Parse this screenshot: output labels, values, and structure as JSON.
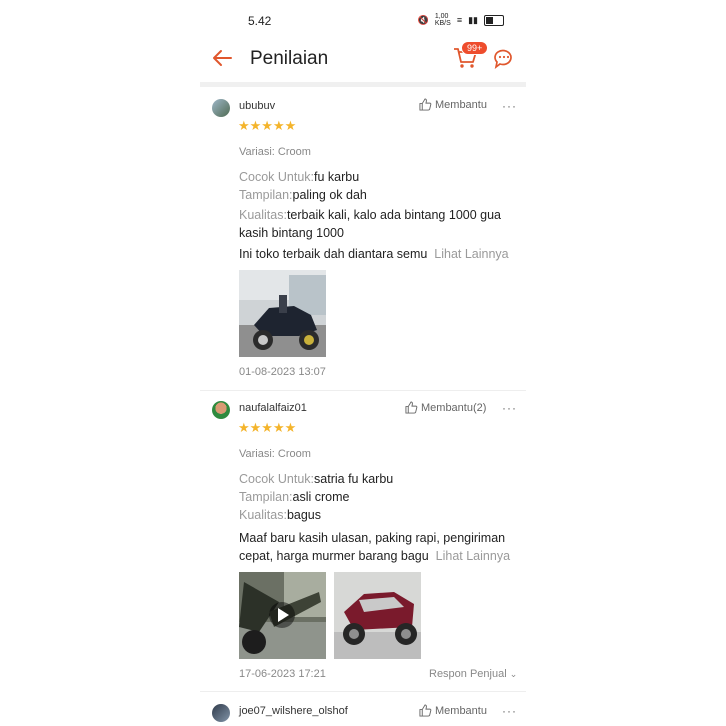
{
  "status_bar": {
    "time": "5.42",
    "network_speed": "1,00 KB/S",
    "icons": [
      "mute-icon",
      "wifi-icon",
      "signal-icon",
      "battery-icon"
    ]
  },
  "header": {
    "title": "Penilaian",
    "cart_badge": "99+",
    "icons": [
      "back-arrow-icon",
      "cart-icon",
      "chat-icon"
    ]
  },
  "colors": {
    "accent": "#ee4d2d",
    "star": "#f4b42b",
    "muted": "#9a9a9a"
  },
  "reviews": [
    {
      "username": "ububuv",
      "helpful_label": "Membantu",
      "rating": 5,
      "variation": "Variasi: Croom",
      "attrs": [
        {
          "key": "Cocok Untuk:",
          "value": "fu karbu"
        },
        {
          "key": "Tampilan:",
          "value": "paling ok dah"
        },
        {
          "key": "Kualitas:",
          "value": "terbaik kali, kalo ada bintang 1000 gua kasih bintang 1000"
        }
      ],
      "body": "Ini toko terbaik dah diantara semu",
      "see_more": "Lihat Lainnya",
      "date": "01-08-2023 13:07"
    },
    {
      "username": "naufalalfaiz01",
      "helpful_label": "Membantu(2)",
      "rating": 5,
      "variation": "Variasi: Croom",
      "attrs": [
        {
          "key": "Cocok Untuk:",
          "value": "satria fu karbu"
        },
        {
          "key": "Tampilan:",
          "value": "asli crome"
        },
        {
          "key": "Kualitas:",
          "value": "bagus"
        }
      ],
      "body": "Maaf baru kasih ulasan, paking rapi, pengiriman cepat, harga murmer barang bagu",
      "see_more": "Lihat Lainnya",
      "date": "17-06-2023 17:21",
      "respond_label": "Respon Penjual"
    },
    {
      "username": "joe07_wilshere_olshof",
      "helpful_label": "Membantu"
    }
  ]
}
